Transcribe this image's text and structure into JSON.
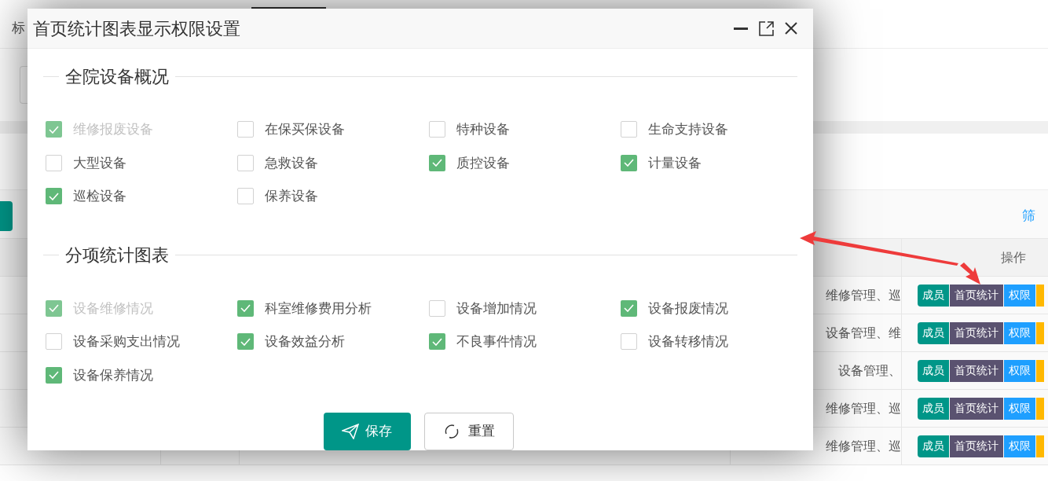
{
  "background": {
    "tab_fragment": "标",
    "filter_link": "筛",
    "table": {
      "action_header": "操作",
      "rows": [
        {
          "modules": "维修管理、巡",
          "actions": [
            "成员",
            "首页统计",
            "权限"
          ]
        },
        {
          "modules": "设备管理、维",
          "actions": [
            "成员",
            "首页统计",
            "权限"
          ]
        },
        {
          "modules": "设备管理、",
          "actions": [
            "成员",
            "首页统计",
            "权限"
          ]
        },
        {
          "modules": "维修管理、巡",
          "actions": [
            "成员",
            "首页统计",
            "权限"
          ]
        },
        {
          "modules": "维修管理、巡",
          "actions": [
            "成员",
            "首页统计",
            "权限"
          ]
        }
      ]
    }
  },
  "dialog": {
    "title": "首页统计图表显示权限设置",
    "sections": [
      {
        "legend": "全院设备概况",
        "options": [
          {
            "label": "维修报废设备",
            "checked": true,
            "disabled": true
          },
          {
            "label": "在保买保设备",
            "checked": false,
            "disabled": false
          },
          {
            "label": "特种设备",
            "checked": false,
            "disabled": false
          },
          {
            "label": "生命支持设备",
            "checked": false,
            "disabled": false
          },
          {
            "label": "大型设备",
            "checked": false,
            "disabled": false
          },
          {
            "label": "急救设备",
            "checked": false,
            "disabled": false
          },
          {
            "label": "质控设备",
            "checked": true,
            "disabled": false
          },
          {
            "label": "计量设备",
            "checked": true,
            "disabled": false
          },
          {
            "label": "巡检设备",
            "checked": true,
            "disabled": false
          },
          {
            "label": "保养设备",
            "checked": false,
            "disabled": false
          }
        ]
      },
      {
        "legend": "分项统计图表",
        "options": [
          {
            "label": "设备维修情况",
            "checked": true,
            "disabled": true
          },
          {
            "label": "科室维修费用分析",
            "checked": true,
            "disabled": false
          },
          {
            "label": "设备增加情况",
            "checked": false,
            "disabled": false
          },
          {
            "label": "设备报废情况",
            "checked": true,
            "disabled": false
          },
          {
            "label": "设备采购支出情况",
            "checked": false,
            "disabled": false
          },
          {
            "label": "设备效益分析",
            "checked": true,
            "disabled": false
          },
          {
            "label": "不良事件情况",
            "checked": true,
            "disabled": false
          },
          {
            "label": "设备转移情况",
            "checked": false,
            "disabled": false
          },
          {
            "label": "设备保养情况",
            "checked": true,
            "disabled": false
          }
        ]
      }
    ],
    "buttons": [
      {
        "kind": "save",
        "label": "保存"
      },
      {
        "kind": "reset",
        "label": "重置"
      }
    ]
  }
}
